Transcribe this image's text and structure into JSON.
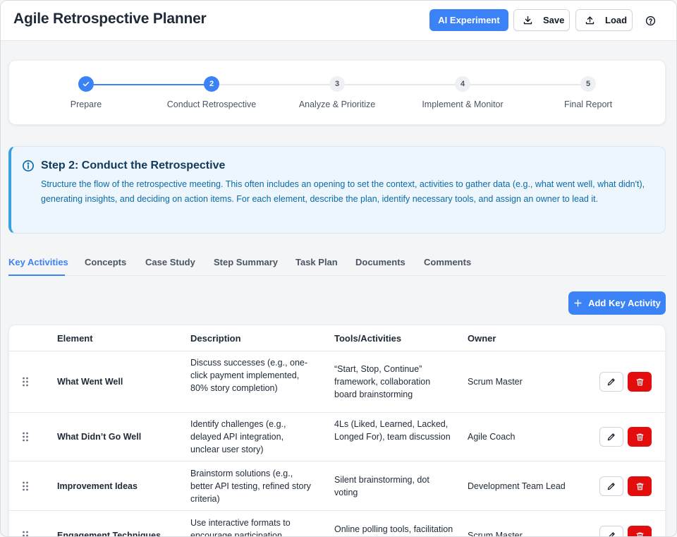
{
  "header": {
    "title": "Agile Retrospective Planner",
    "ai_button": "AI Experiment",
    "save_label": "Save",
    "load_label": "Load"
  },
  "stepper": {
    "steps": [
      {
        "number": "1",
        "label": "Prepare",
        "state": "done"
      },
      {
        "number": "2",
        "label": "Conduct Retrospective",
        "state": "active"
      },
      {
        "number": "3",
        "label": "Analyze & Prioritize",
        "state": "pending"
      },
      {
        "number": "4",
        "label": "Implement & Monitor",
        "state": "pending"
      },
      {
        "number": "5",
        "label": "Final Report",
        "state": "pending"
      }
    ]
  },
  "info": {
    "title": "Step 2: Conduct the Retrospective",
    "body": "Structure the flow of the retrospective meeting. This often includes an opening to set the context, activities to gather data (e.g., what went well, what didn't), generating insights, and deciding on action items. For each element, describe the plan, identify necessary tools, and assign an owner to lead it."
  },
  "tabs": [
    "Key Activities",
    "Concepts",
    "Case Study",
    "Step Summary",
    "Task Plan",
    "Documents",
    "Comments"
  ],
  "add_button": "Add Key Activity",
  "table": {
    "headers": {
      "element": "Element",
      "description": "Description",
      "tools": "Tools/Activities",
      "owner": "Owner"
    },
    "rows": [
      {
        "element": "What Went Well",
        "description": "Discuss successes (e.g., one-click payment implemented, 80% story completion)",
        "tools": "“Start, Stop, Continue” framework, collaboration board brainstorming",
        "owner": "Scrum Master"
      },
      {
        "element": "What Didn’t Go Well",
        "description": "Identify challenges (e.g., delayed API integration, unclear user story)",
        "tools": "4Ls (Liked, Learned, Lacked, Longed For), team discussion",
        "owner": "Agile Coach"
      },
      {
        "element": "Improvement Ideas",
        "description": "Brainstorm solutions (e.g., better API testing, refined story criteria)",
        "tools": "Silent brainstorming, dot voting",
        "owner": "Development Team Lead"
      },
      {
        "element": "Engagement Techniques",
        "description": "Use interactive formats to encourage participation",
        "tools": "Online polling tools, facilitation techniques",
        "owner": "Scrum Master"
      }
    ]
  },
  "colors": {
    "accent": "#3b82f6",
    "danger": "#e30d0d",
    "info_border": "#3aa0e0"
  }
}
